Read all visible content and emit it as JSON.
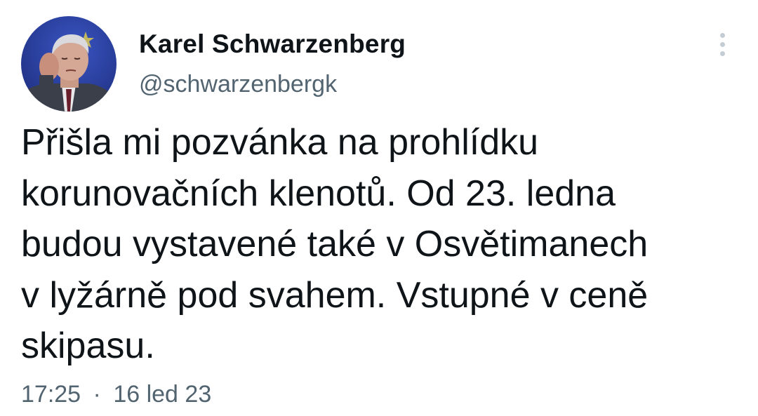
{
  "author": {
    "display_name": "Karel Schwarzenberg",
    "handle": "@schwarzenbergk",
    "avatar_icon": "profile-photo"
  },
  "menu": {
    "icon": "more-vertical-icon"
  },
  "tweet": {
    "lines": [
      "Přišla mi pozvánka na prohlídku",
      "korunovačních klenotů. Od 23. ledna",
      "budou vystavené také v Osvětimanech",
      "v lyžárně pod svahem. Vstupné v ceně",
      "skipasu."
    ]
  },
  "meta": {
    "time": "17:25",
    "separator": "·",
    "date": "16 led 23"
  },
  "colors": {
    "text_primary": "#0f1419",
    "text_secondary": "#536471",
    "avatar_background": "#2b3f9e"
  }
}
